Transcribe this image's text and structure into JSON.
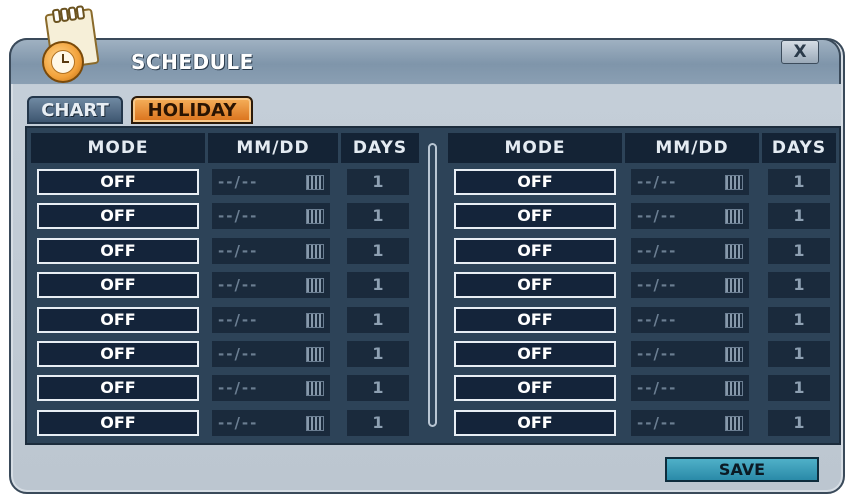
{
  "window": {
    "title": "SCHEDULE",
    "close_label": "X"
  },
  "tabs": [
    {
      "label": "CHART",
      "active": false
    },
    {
      "label": "HOLIDAY",
      "active": true
    }
  ],
  "columns": {
    "mode": "MODE",
    "date": "MM/DD",
    "days": "DAYS"
  },
  "left_rows": [
    {
      "mode": "OFF",
      "date": "--/--",
      "days": "1"
    },
    {
      "mode": "OFF",
      "date": "--/--",
      "days": "1"
    },
    {
      "mode": "OFF",
      "date": "--/--",
      "days": "1"
    },
    {
      "mode": "OFF",
      "date": "--/--",
      "days": "1"
    },
    {
      "mode": "OFF",
      "date": "--/--",
      "days": "1"
    },
    {
      "mode": "OFF",
      "date": "--/--",
      "days": "1"
    },
    {
      "mode": "OFF",
      "date": "--/--",
      "days": "1"
    },
    {
      "mode": "OFF",
      "date": "--/--",
      "days": "1"
    }
  ],
  "right_rows": [
    {
      "mode": "OFF",
      "date": "--/--",
      "days": "1"
    },
    {
      "mode": "OFF",
      "date": "--/--",
      "days": "1"
    },
    {
      "mode": "OFF",
      "date": "--/--",
      "days": "1"
    },
    {
      "mode": "OFF",
      "date": "--/--",
      "days": "1"
    },
    {
      "mode": "OFF",
      "date": "--/--",
      "days": "1"
    },
    {
      "mode": "OFF",
      "date": "--/--",
      "days": "1"
    },
    {
      "mode": "OFF",
      "date": "--/--",
      "days": "1"
    },
    {
      "mode": "OFF",
      "date": "--/--",
      "days": "1"
    }
  ],
  "footer": {
    "save_label": "SAVE"
  },
  "colors": {
    "active_tab": "#e8892e",
    "panel_bg": "#2d4358",
    "header_bg": "#142335",
    "save_button": "#3a9fbb"
  },
  "icons": {
    "window_icon": "clock-notepad-icon",
    "date_picker": "calendar-icon"
  }
}
